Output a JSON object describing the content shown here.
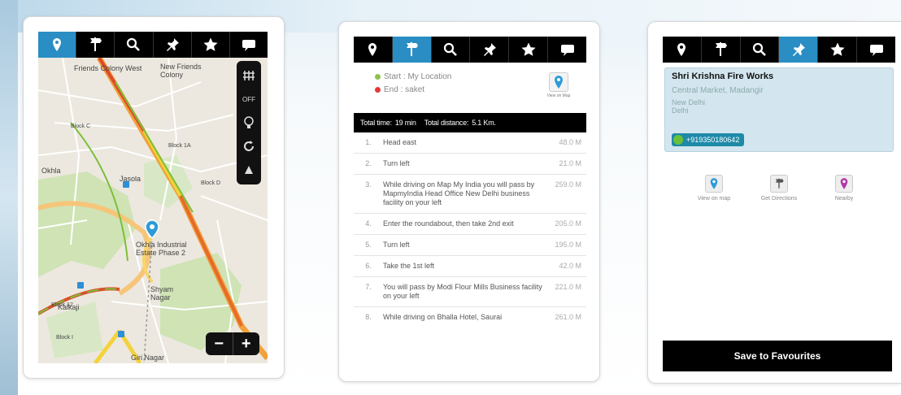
{
  "toolbar": {
    "icons": [
      "location-pin-icon",
      "directions-icon",
      "search-icon",
      "pushpin-icon",
      "star-icon",
      "message-icon"
    ],
    "active_color": "#2a8ec4"
  },
  "map_screen": {
    "labels": {
      "new_friends_colony": "New Friends Colony",
      "friends_colony": "Friends Colony West",
      "okhla": "Okhla",
      "bhikaji": "Okhla Industrial Estate Phase 2",
      "shyam_nagar": "Shyam Nagar",
      "kalkaji": "Kalkaji",
      "giri_nagar": "Giri Nagar",
      "jasola": "Jasola",
      "block_12": "Block 12",
      "block_c": "Block C",
      "block_1a": "Block 1A",
      "block_d": "Block D",
      "block_i": "Block I"
    },
    "controls": {
      "off_label": "OFF"
    },
    "zoom": {
      "minus": "−",
      "plus": "+"
    }
  },
  "directions_screen": {
    "start_label": "Start : My Location",
    "end_label": "End : saket",
    "view_map_label": "View on Map",
    "summary": {
      "total_time_label": "Total time:",
      "total_time_value": "19 min",
      "total_distance_label": "Total distance:",
      "total_distance_value": "5.1 Km."
    },
    "steps": [
      {
        "num": "1.",
        "text": "Head east",
        "dist": "48.0 M"
      },
      {
        "num": "2.",
        "text": "Turn left",
        "dist": "21.0 M"
      },
      {
        "num": "3.",
        "text": "While driving on Map My India you will pass by MapmyIndia Head Office New Delhi business facility on your left",
        "dist": "259.0 M"
      },
      {
        "num": "4.",
        "text": "Enter the roundabout, then take 2nd exit",
        "dist": "205.0 M"
      },
      {
        "num": "5.",
        "text": "Turn left",
        "dist": "195.0 M"
      },
      {
        "num": "6.",
        "text": "Take the 1st left",
        "dist": "42.0 M"
      },
      {
        "num": "7.",
        "text": "You will pass by Modi Flour Mills Business facility on your left",
        "dist": "221.0 M"
      },
      {
        "num": "8.",
        "text": "While driving on Bhalla Hotel, Saurai",
        "dist": "261.0 M"
      }
    ]
  },
  "details_screen": {
    "place_name": "Shri Krishna Fire Works",
    "address_line1": "Central Market, Madangir",
    "address_line2": "New Delhi",
    "address_line3": "Delhi",
    "phone": "+919350180642",
    "actions": [
      {
        "label": "View on map",
        "icon": "location-pin-icon",
        "color": "#2a8ec4"
      },
      {
        "label": "Get Directions",
        "icon": "directions-icon",
        "color": "#555555"
      },
      {
        "label": "Nearby",
        "icon": "nearby-pin-icon",
        "color": "#b03aa8"
      }
    ],
    "save_label": "Save to Favourites"
  }
}
